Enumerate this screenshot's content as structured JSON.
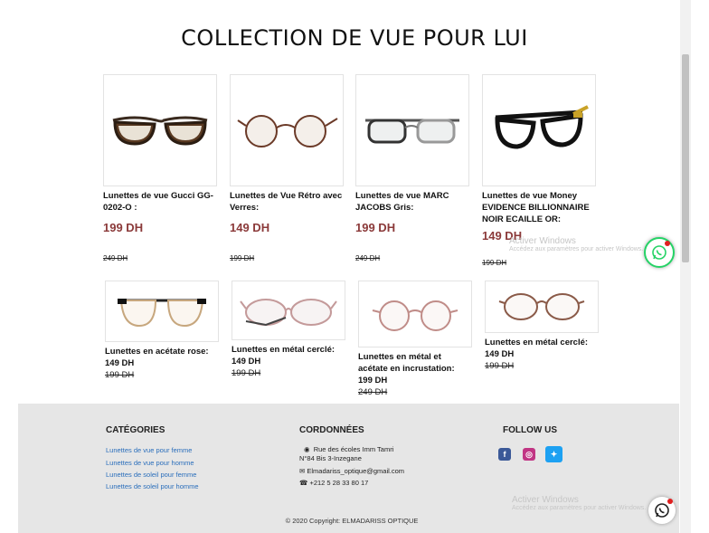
{
  "page_title": "COLLECTION DE VUE POUR LUI",
  "products_row1": [
    {
      "name": "Lunettes de vue Gucci GG-0202-O :",
      "price": "199 DH",
      "old_price": "249 DH"
    },
    {
      "name": "Lunettes de Vue Rétro avec Verres:",
      "price": "149 DH",
      "old_price": "199 DH"
    },
    {
      "name": "Lunettes de vue MARC JACOBS Gris:",
      "price": "199 DH",
      "old_price": "249 DH"
    },
    {
      "name": "Lunettes de vue Money EVIDENCE BILLIONNAIRE NOIR ECAILLE OR:",
      "price": "149 DH",
      "old_price": "199 DH"
    }
  ],
  "products_row2": [
    {
      "name": "Lunettes en acétate rose:",
      "price": "149 DH",
      "old_price": "199 DH"
    },
    {
      "name": "Lunettes en métal cerclé:",
      "price": "149 DH",
      "old_price": "199 DH"
    },
    {
      "name": "Lunettes en métal et acétate en incrustation:",
      "price": "199 DH",
      "old_price": "249 DH"
    },
    {
      "name": "Lunettes en métal cerclé:",
      "price": "149 DH",
      "old_price": "199 DH"
    }
  ],
  "footer": {
    "categories_title": "CATÉGORIES",
    "categories": [
      "Lunettes de vue pour femme",
      "Lunettes de vue pour homme",
      "Lunettes de soleil pour femme",
      "Lunettes de soleil pour homme"
    ],
    "contact_title": "CORDONNÉES",
    "address_line1": "Rue des écoles Imm Tamri",
    "address_line2": "N°84 Bis 3-Inzegane",
    "email": "Elmadariss_optique@gmail.com",
    "phone": "+212 5 28 33 80 17",
    "follow_title": "FOLLOW US",
    "social_icons": [
      "facebook-icon",
      "instagram-icon",
      "twitter-icon"
    ],
    "copyright": "© 2020 Copyright: ELMADARISS OPTIQUE"
  },
  "windows_watermark": {
    "title": "Activer Windows",
    "subtitle": "Accédez aux paramètres pour activer Windows."
  },
  "colors": {
    "price": "#8b3a3a",
    "link": "#2a6ebb",
    "footer_bg": "#e6e6e6",
    "whatsapp": "#25d366"
  }
}
